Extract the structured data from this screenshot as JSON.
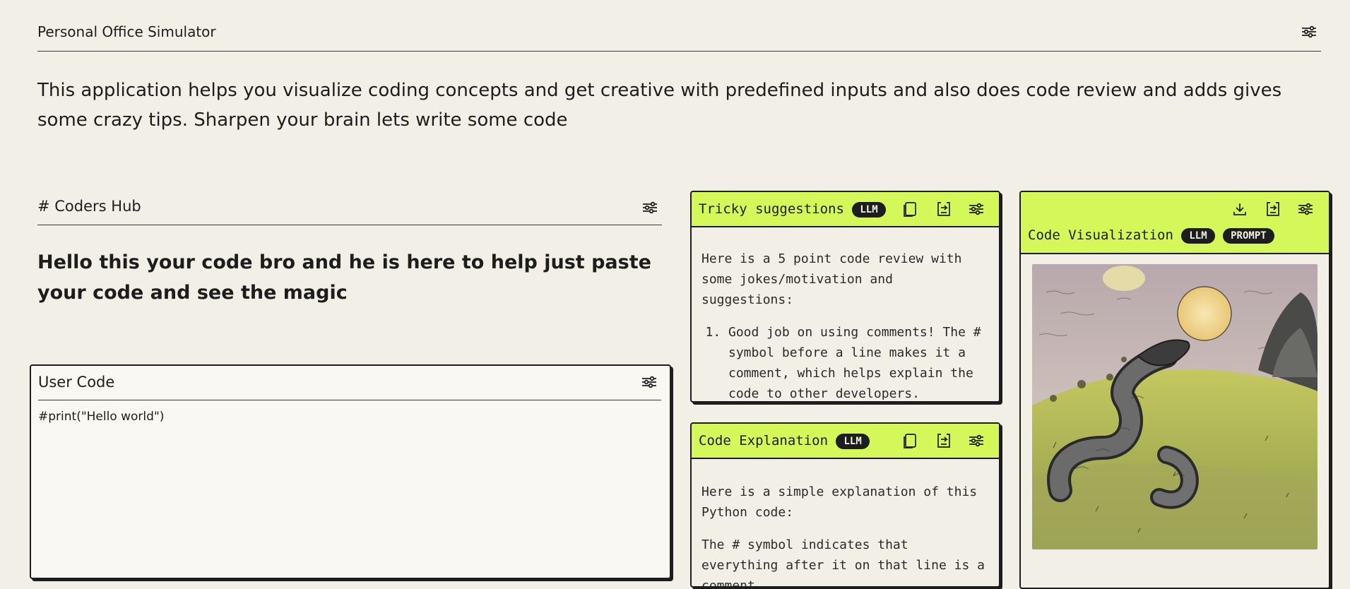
{
  "app": {
    "title": "Personal Office Simulator"
  },
  "description": "This application helps you visualize coding concepts and get creative with predefined inputs and also does code review and adds gives some crazy tips. Sharpen your brain lets write some code",
  "hub": {
    "title": "# Coders Hub",
    "greeting": "Hello this your code bro and he is here to help just paste your code and see the magic"
  },
  "user_code": {
    "label": "User Code",
    "value": "#print(\"Hello world\")"
  },
  "tricky": {
    "title": "Tricky suggestions",
    "badge": "LLM",
    "intro": "Here is a 5 point code review with some jokes/motivation and suggestions:",
    "items": [
      "Good job on using comments! The # symbol before a line makes it a comment, which helps explain the code to other developers."
    ]
  },
  "explanation": {
    "title": "Code Explanation",
    "badge": "LLM",
    "intro": "Here is a simple explanation of this Python code:",
    "para": "The # symbol indicates that everything after it on that line is a comment."
  },
  "visualization": {
    "title": "Code Visualization",
    "badges": [
      "LLM",
      "PROMPT"
    ]
  },
  "icons": {
    "settings": "tune-icon",
    "copy": "copy-icon",
    "share": "share-icon",
    "download": "download-icon"
  },
  "colors": {
    "background": "#f2f0e6",
    "accent": "#d4f75a",
    "ink": "#1d1d1d"
  }
}
